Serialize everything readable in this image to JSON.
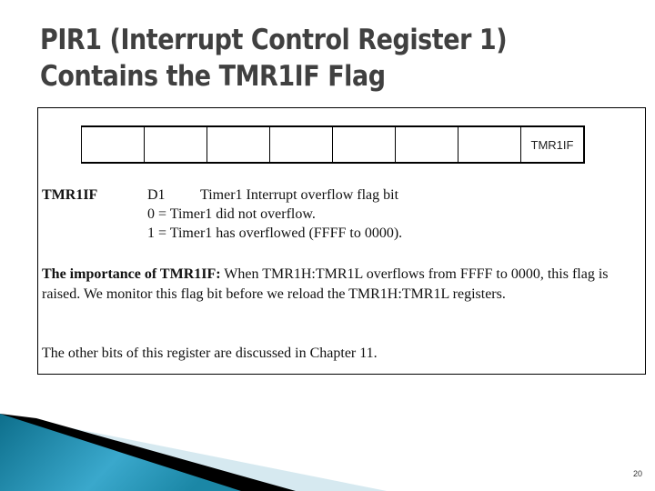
{
  "slide": {
    "title_line1": "PIR1 (Interrupt Control Register 1)",
    "title_line2": "Contains the TMR1IF Flag",
    "page_number": "20"
  },
  "register": {
    "bits": [
      "",
      "",
      "",
      "",
      "",
      "",
      "",
      "TMR1IF"
    ]
  },
  "bit_description": {
    "name": "TMR1IF",
    "position": "D1",
    "description": "Timer1 Interrupt overflow flag bit",
    "value0": "0 = Timer1  did not overflow.",
    "value1": "1 = Timer1  has overflowed (FFFF to 0000)."
  },
  "importance": {
    "label": "The importance of TMR1IF:",
    "text": " When TMR1H:TMR1L overflows from FFFF to 0000, this flag is raised. We monitor this flag bit before we reload the TMR1H:TMR1L registers."
  },
  "note": "The other bits of this register are discussed in Chapter 11.",
  "colors": {
    "title": "#404040",
    "deco_teal": "#1f8aa8",
    "deco_light": "#d6e9f0"
  }
}
